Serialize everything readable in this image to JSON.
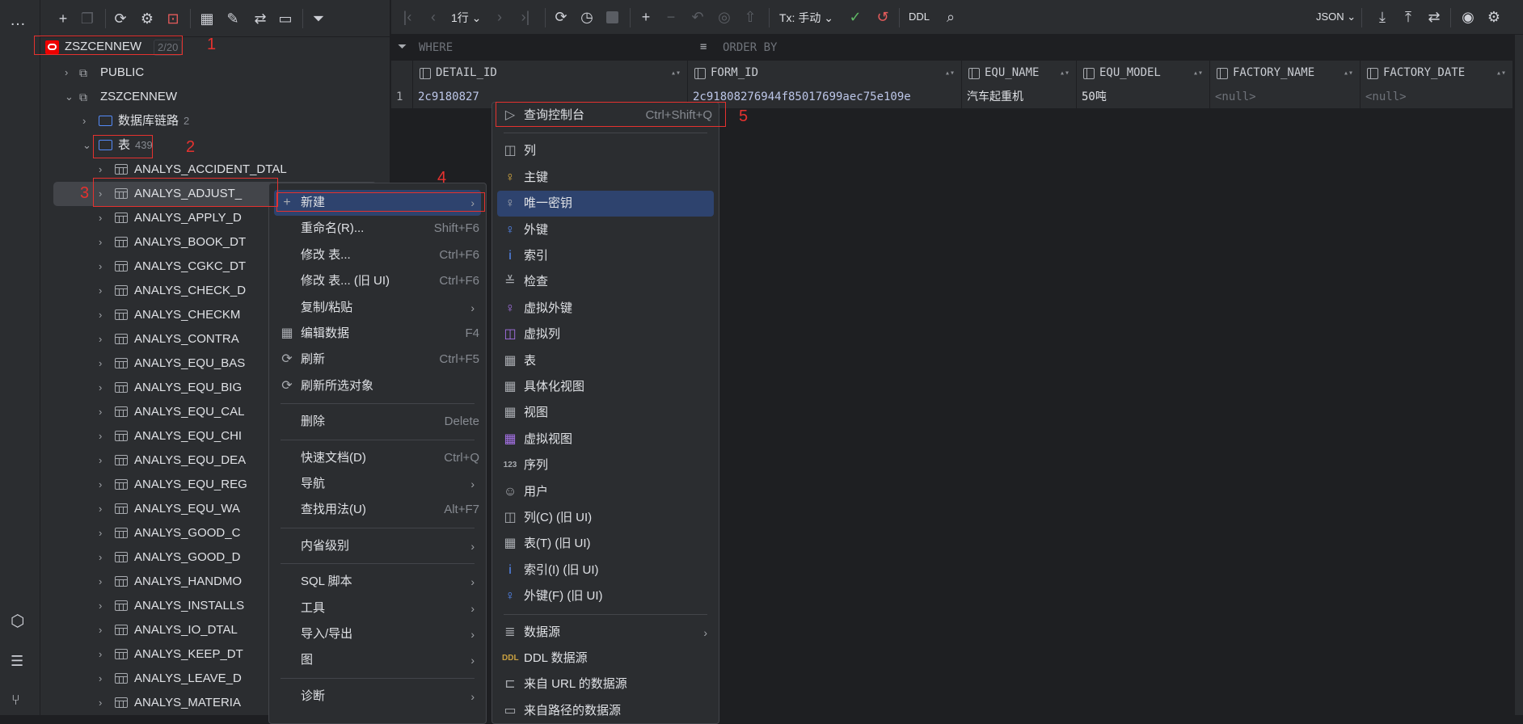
{
  "left_strip": {
    "more": "…",
    "icons": [
      "services-icon",
      "database-explorer-icon",
      "git-icon"
    ]
  },
  "tree": {
    "root": {
      "label": "ZSZCENNEW",
      "badge": "2/20"
    },
    "schemas": [
      {
        "label": "PUBLIC"
      },
      {
        "label": "ZSZCENNEW"
      }
    ],
    "db_links": {
      "label": "数据库链路",
      "count": "2"
    },
    "tables_folder": {
      "label": "表",
      "count": "439"
    },
    "tables": [
      "ANALYS_ACCIDENT_DTAL",
      "ANALYS_ADJUST_",
      "ANALYS_APPLY_D",
      "ANALYS_BOOK_DT",
      "ANALYS_CGKC_DT",
      "ANALYS_CHECK_D",
      "ANALYS_CHECKM",
      "ANALYS_CONTRA",
      "ANALYS_EQU_BAS",
      "ANALYS_EQU_BIG",
      "ANALYS_EQU_CAL",
      "ANALYS_EQU_CHI",
      "ANALYS_EQU_DEA",
      "ANALYS_EQU_REG",
      "ANALYS_EQU_WA",
      "ANALYS_GOOD_C",
      "ANALYS_GOOD_D",
      "ANALYS_HANDMO",
      "ANALYS_INSTALLS",
      "ANALYS_IO_DTAL",
      "ANALYS_KEEP_DT",
      "ANALYS_LEAVE_D",
      "ANALYS_MATERIA"
    ]
  },
  "data_toolbar": {
    "rows": "1行",
    "tx": "Tx: 手动",
    "ddl": "DDL",
    "format": "JSON"
  },
  "filter": {
    "where": "WHERE",
    "order_by": "ORDER BY"
  },
  "grid": {
    "columns": [
      "DETAIL_ID",
      "FORM_ID",
      "EQU_NAME",
      "EQU_MODEL",
      "FACTORY_NAME",
      "FACTORY_DATE"
    ],
    "rows": [
      {
        "num": "1",
        "cells": [
          "2c9180827",
          "2c91808276944f85017699aec75e109e",
          "汽车起重机",
          "50吨",
          "<null>",
          "<null>"
        ]
      }
    ]
  },
  "context_menu": [
    {
      "label": "新建",
      "icon": "+",
      "arrow": true,
      "highlight": true
    },
    {
      "label": "重命名(R)...",
      "shortcut": "Shift+F6"
    },
    {
      "label": "修改 表...",
      "shortcut": "Ctrl+F6"
    },
    {
      "label": "修改 表... (旧 UI)",
      "shortcut": "Ctrl+F6"
    },
    {
      "label": "复制/粘贴",
      "arrow": true
    },
    {
      "label": "编辑数据",
      "icon": "▦",
      "shortcut": "F4"
    },
    {
      "label": "刷新",
      "icon": "⟳",
      "shortcut": "Ctrl+F5"
    },
    {
      "label": "刷新所选对象",
      "icon": "⟳"
    },
    {
      "sep": true
    },
    {
      "label": "删除",
      "shortcut": "Delete"
    },
    {
      "sep": true
    },
    {
      "label": "快速文档(D)",
      "shortcut": "Ctrl+Q"
    },
    {
      "label": "导航",
      "arrow": true
    },
    {
      "label": "查找用法(U)",
      "shortcut": "Alt+F7"
    },
    {
      "sep": true
    },
    {
      "label": "内省级别",
      "arrow": true
    },
    {
      "sep": true
    },
    {
      "label": "SQL 脚本",
      "arrow": true
    },
    {
      "label": "工具",
      "arrow": true
    },
    {
      "label": "导入/导出",
      "arrow": true
    },
    {
      "label": "图",
      "arrow": true
    },
    {
      "sep": true
    },
    {
      "label": "诊断",
      "arrow": true
    }
  ],
  "submenu": [
    {
      "label": "查询控制台",
      "icon": "▷",
      "shortcut": "Ctrl+Shift+Q"
    },
    {
      "sep": true
    },
    {
      "label": "列",
      "icon": "◫"
    },
    {
      "label": "主键",
      "icon": "♀",
      "color": "#e0b040"
    },
    {
      "label": "唯一密钥",
      "icon": "♀",
      "highlight": true
    },
    {
      "label": "外键",
      "icon": "♀",
      "color": "#548af7"
    },
    {
      "label": "索引",
      "icon": "i",
      "color": "#548af7"
    },
    {
      "label": "检查",
      "icon": "≚"
    },
    {
      "label": "虚拟外键",
      "icon": "♀",
      "color": "#a571e6"
    },
    {
      "label": "虚拟列",
      "icon": "◫",
      "color": "#a571e6"
    },
    {
      "label": "表",
      "icon": "▦"
    },
    {
      "label": "具体化视图",
      "icon": "▦"
    },
    {
      "label": "视图",
      "icon": "▦"
    },
    {
      "label": "虚拟视图",
      "icon": "▦",
      "color": "#a571e6"
    },
    {
      "label": "序列",
      "icon": "123"
    },
    {
      "label": "用户",
      "icon": "☺"
    },
    {
      "label": "列(C) (旧 UI)",
      "icon": "◫"
    },
    {
      "label": "表(T) (旧 UI)",
      "icon": "▦"
    },
    {
      "label": "索引(I) (旧 UI)",
      "icon": "i",
      "color": "#548af7"
    },
    {
      "label": "外键(F) (旧 UI)",
      "icon": "♀",
      "color": "#548af7"
    },
    {
      "sep": true
    },
    {
      "label": "数据源",
      "icon": "≣",
      "arrow": true
    },
    {
      "label": "DDL 数据源",
      "icon": "DDL",
      "color": "#c9a040"
    },
    {
      "label": "来自 URL 的数据源",
      "icon": "⊏"
    },
    {
      "label": "来自路径的数据源",
      "icon": "▭"
    }
  ],
  "annotations": [
    "1",
    "2",
    "3",
    "4",
    "5"
  ],
  "colors": {
    "accent": "#2e436e",
    "annotation": "#e5322f",
    "folder": "#548af7"
  }
}
